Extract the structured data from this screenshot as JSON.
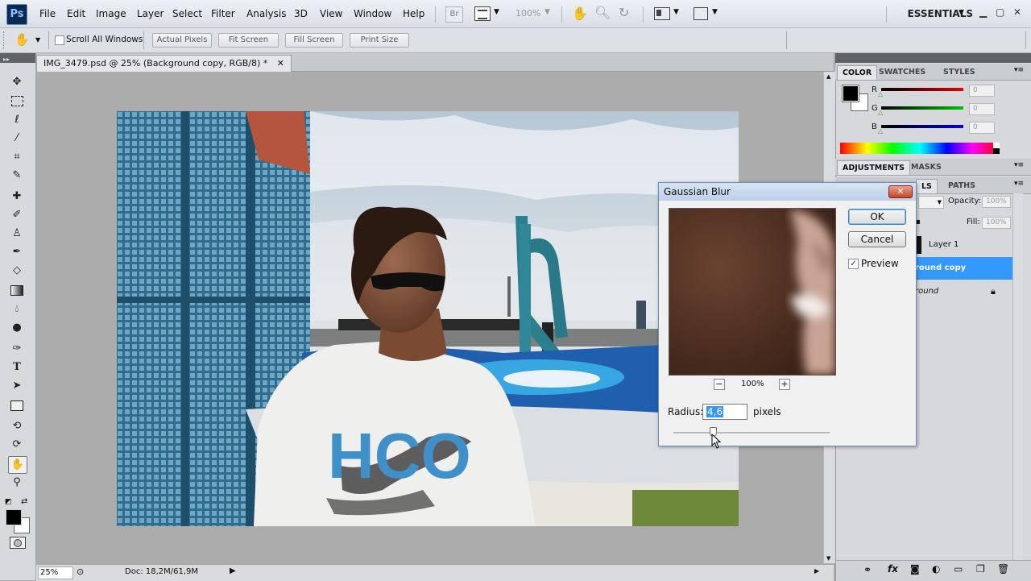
{
  "menubar": {
    "logo": "Ps",
    "items": [
      "File",
      "Edit",
      "Image",
      "Layer",
      "Select",
      "Filter",
      "Analysis",
      "3D",
      "View",
      "Window",
      "Help"
    ],
    "br_label": "Br",
    "zoom": "100%",
    "workspace": "ESSENTIALS"
  },
  "options": {
    "scroll_all": "Scroll All Windows",
    "actual_pixels": "Actual Pixels",
    "fit_screen": "Fit Screen",
    "fill_screen": "Fill Screen",
    "print_size": "Print Size"
  },
  "document": {
    "tab_title": "IMG_3479.psd @ 25% (Background copy, RGB/8) *",
    "zoom": "25%",
    "doc_size": "Doc: 18,2M/61,9M"
  },
  "photo": {
    "shirt_text": "HCO"
  },
  "color_panel": {
    "tabs": [
      "COLOR",
      "SWATCHES",
      "STYLES"
    ],
    "channels": [
      {
        "label": "R",
        "value": "0",
        "color": "#c00000"
      },
      {
        "label": "G",
        "value": "0",
        "color": "#00a000"
      },
      {
        "label": "B",
        "value": "0",
        "color": "#0000c0"
      }
    ]
  },
  "adjust_panel": {
    "tabs": [
      "ADJUSTMENTS",
      "MASKS"
    ]
  },
  "layers_panel": {
    "tab_partial": "LS",
    "paths_tab": "PATHS",
    "opacity_label": "Opacity:",
    "opacity_value": "100%",
    "fill_label": "Fill:",
    "fill_value": "100%",
    "layers": [
      {
        "name": "Layer 1"
      },
      {
        "name": "round copy"
      },
      {
        "name": "round"
      }
    ]
  },
  "dialog": {
    "title": "Gaussian Blur",
    "ok": "OK",
    "cancel": "Cancel",
    "preview_label": "Preview",
    "zoom": "100%",
    "minus": "−",
    "plus": "+",
    "radius_label": "Radius:",
    "radius_value": "4,6",
    "units": "pixels",
    "radius_fraction": 0.25
  }
}
